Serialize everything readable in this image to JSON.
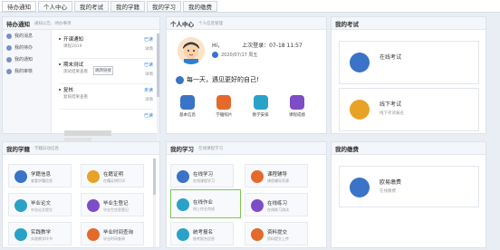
{
  "topnav": {
    "tabs": [
      {
        "label": "待办通知"
      },
      {
        "label": "个人中心"
      },
      {
        "label": "我的考试"
      },
      {
        "label": "我的学籍"
      },
      {
        "label": "我的学习"
      },
      {
        "label": "我的缴费"
      }
    ]
  },
  "todo": {
    "title": "待办通知",
    "subtitle": "通知公告、待办事项",
    "side": [
      {
        "label": "我的消息"
      },
      {
        "label": "我的待办"
      },
      {
        "label": "我的通知"
      },
      {
        "label": "我的审核"
      }
    ],
    "items": [
      {
        "title": "开课通知",
        "sub": "课程2019",
        "action": "已读",
        "action2": "详情"
      },
      {
        "title": "期末测试",
        "sub": "测试结果查看",
        "action": "已读",
        "action2": "详情"
      },
      {
        "title": "复核",
        "sub": "复核结果查看",
        "action": "未读",
        "action2": "详情"
      },
      {
        "title": "",
        "sub": "",
        "action": "已读",
        "action2": ""
      }
    ],
    "tooltip": "跳转链接"
  },
  "personal": {
    "title": "个人中心",
    "subtitle": "个人信息管理",
    "greeting": "Hi，　　　　上次登录：07-18 11:57",
    "date": "2020/07/17 周五",
    "slogan": "每一天，遇见更好的自己!",
    "buttons": [
      {
        "label": "基本信息",
        "color": "#3a73c7"
      },
      {
        "label": "学籍照片",
        "color": "#e36a2a"
      },
      {
        "label": "教学安排",
        "color": "#2aa2c7"
      },
      {
        "label": "课程成绩",
        "color": "#7d4cc7"
      }
    ]
  },
  "exam": {
    "title": "我的考试",
    "cards": [
      {
        "title": "在线考试",
        "sub": "",
        "color": "#3a73c7"
      },
      {
        "title": "线下考试",
        "sub": "线下考试报名",
        "color": "#e8a327"
      }
    ]
  },
  "xueji": {
    "title": "我的学籍",
    "subtitle": "学籍异动信息",
    "cards": [
      {
        "title": "学籍信息",
        "sub": "查看学籍信息",
        "color": "#3a73c7"
      },
      {
        "title": "在籍证明",
        "sub": "在籍证明打印",
        "color": "#e8a327"
      },
      {
        "title": "毕业论文",
        "sub": "毕业论文提交",
        "color": "#2aa2c7"
      },
      {
        "title": "毕业生登记",
        "sub": "毕业生信息登记",
        "color": "#7d4cc7"
      },
      {
        "title": "实践教学",
        "sub": "实践教学环节",
        "color": "#2aa2c7"
      },
      {
        "title": "毕业时间查询",
        "sub": "毕业时间查询",
        "color": "#e36a2a"
      }
    ]
  },
  "study": {
    "title": "我的学习",
    "subtitle": "在线课程学习",
    "cards": [
      {
        "title": "在线学习",
        "sub": "在线课程学习",
        "color": "#3a73c7",
        "hl": false
      },
      {
        "title": "课程辅导",
        "sub": "课程辅导资源",
        "color": "#e36a2a",
        "hl": false
      },
      {
        "title": "在线作业",
        "sub": "线上作业完成",
        "color": "#2aa2c7",
        "hl": true
      },
      {
        "title": "在线练习",
        "sub": "在线练习测试",
        "color": "#7d4cc7",
        "hl": false
      },
      {
        "title": "统考报名",
        "sub": "统考报名信息",
        "color": "#2aa2c7",
        "hl": false
      },
      {
        "title": "资料提交",
        "sub": "资料提交上传",
        "color": "#e36a2a",
        "hl": false
      }
    ]
  },
  "fee": {
    "title": "我的缴费",
    "cards": [
      {
        "title": "欧易缴费",
        "sub": "在线缴费",
        "color": "#3a73c7"
      }
    ]
  }
}
